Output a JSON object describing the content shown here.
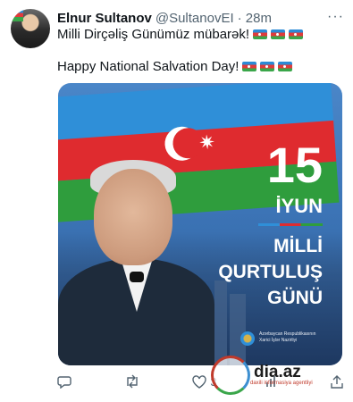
{
  "tweet": {
    "author": {
      "name": "Elnur Sultanov",
      "handle": "@SultanovEI",
      "time": "· 28m"
    },
    "line1": "Milli Dirçəliş Günümüz mübarək!",
    "line2": "Happy National Salvation Day!",
    "flag_colors": [
      "#2f8fd8",
      "#df2b2f",
      "#2f9d3d"
    ]
  },
  "poster": {
    "day": "15",
    "month": "İYUN",
    "title_lines": [
      "MİLLİ",
      "QURTULUŞ",
      "GÜNÜ"
    ],
    "ministry_lines": [
      "Azərbaycan Respublikasının",
      "Xarici İşlər Nazirliyi"
    ]
  },
  "actions": {
    "reply": "",
    "retweet": "",
    "like": "3",
    "views": "",
    "share": ""
  },
  "watermark": {
    "text": "dia.az",
    "sub": "daxili informasiya agentliyi"
  },
  "icons": {
    "more": "more-icon",
    "reply": "reply-icon",
    "retweet": "retweet-icon",
    "like": "heart-icon",
    "views": "views-icon",
    "share": "share-icon"
  }
}
